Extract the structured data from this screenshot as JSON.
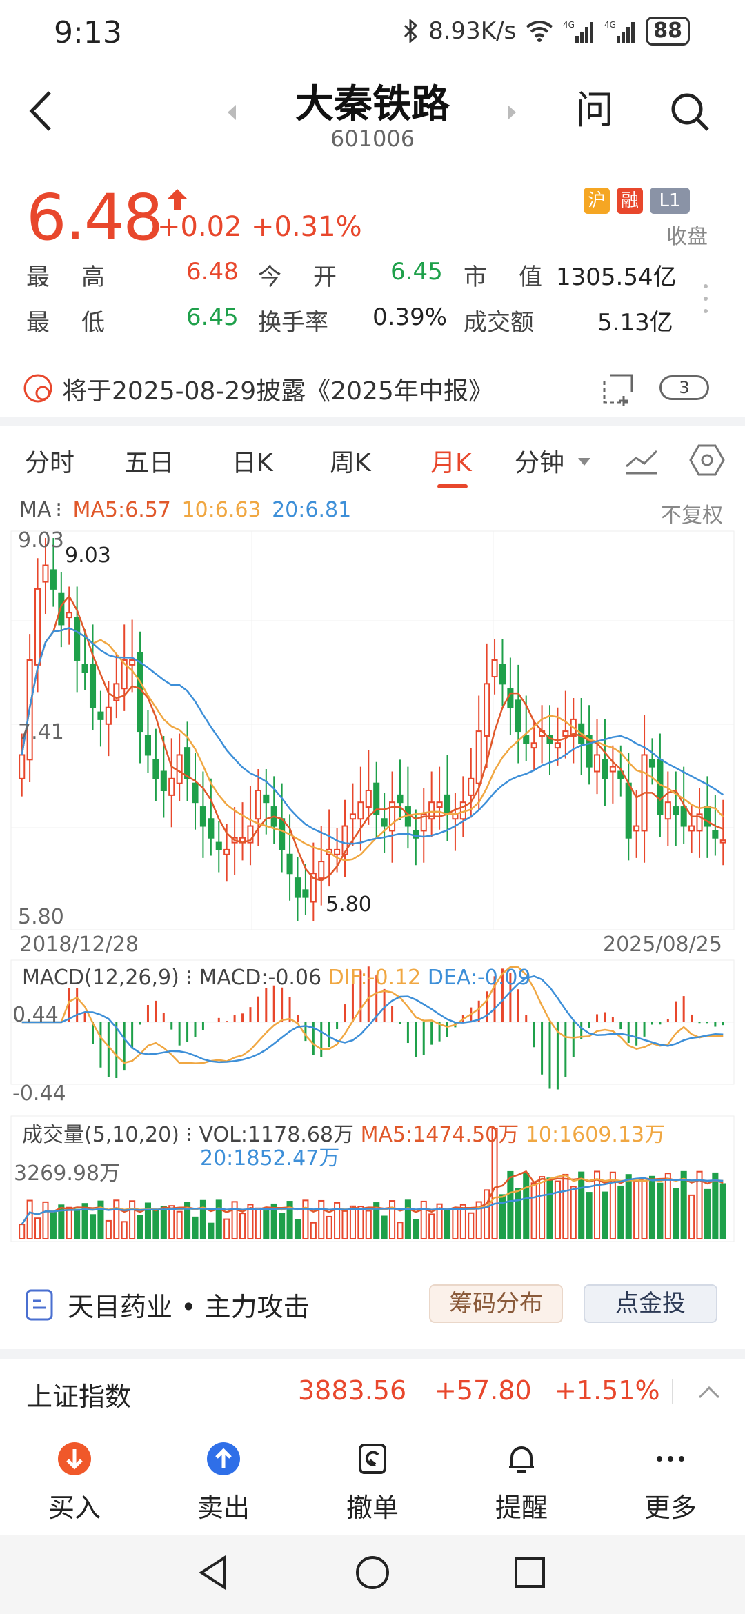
{
  "status_bar": {
    "time": "9:13",
    "net_speed": "8.93K/s",
    "battery": "88",
    "signal1": "4G",
    "signal2": "4G"
  },
  "nav": {
    "title": "大秦铁路",
    "code": "601006",
    "ask_label": "问"
  },
  "quote": {
    "price": "6.48",
    "change": "+0.02",
    "change_pct": "+0.31%",
    "badges": {
      "sh": "沪",
      "rong": "融",
      "level": "L1"
    },
    "status": "收盘",
    "high_label": "最　高",
    "high": "6.48",
    "open_label": "今　开",
    "open": "6.45",
    "mktcap_label": "市　值",
    "mktcap": "1305.54亿",
    "low_label": "最　低",
    "low": "6.45",
    "turnover_label": "换手率",
    "turnover": "0.39%",
    "amount_label": "成交额",
    "amount": "5.13亿"
  },
  "disclosure": {
    "text": "将于2025-08-29披露《2025年中报》",
    "count": "3"
  },
  "tabs": [
    {
      "label": "分时"
    },
    {
      "label": "五日"
    },
    {
      "label": "日K"
    },
    {
      "label": "周K"
    },
    {
      "label": "月K"
    },
    {
      "label": "分钟"
    }
  ],
  "chart": {
    "ma_prefix": "MA",
    "ma5": "MA5:6.57",
    "ma10": "10:6.63",
    "ma20": "20:6.81",
    "adjust": "不复权",
    "y_top": "9.03",
    "y_mid": "7.41",
    "y_bottom": "5.80",
    "max_marker": "9.03",
    "min_marker": "5.80",
    "date_start": "2018/12/28",
    "date_end": "2025/08/25",
    "macd_title": "MACD(12,26,9)",
    "macd_val": "MACD:-0.06",
    "dif": "DIF:-0.12",
    "dea": "DEA:-0.09",
    "macd_top": "0.44",
    "macd_bottom": "-0.44",
    "vol_title": "成交量(5,10,20)",
    "vol": "VOL:1178.68万",
    "vol_ma5": "MA5:1474.50万",
    "vol_ma10": "10:1609.13万",
    "vol_ma20": "20:1852.47万",
    "vol_max": "3269.98万",
    "colors": {
      "up": "#e8472c",
      "down": "#1ea04a",
      "ma5": "#e0582a",
      "ma10": "#f0a742",
      "ma20": "#3d8fd8"
    }
  },
  "chart_data": {
    "type": "candlestick",
    "title": "月K",
    "ylim": [
      5.8,
      9.03
    ],
    "closes": [
      7.2,
      8.0,
      8.6,
      8.8,
      8.6,
      8.3,
      8.4,
      8.0,
      7.9,
      7.6,
      7.5,
      7.6,
      7.8,
      8.0,
      8.0,
      7.4,
      7.2,
      7.0,
      6.9,
      7.0,
      7.2,
      7.0,
      6.8,
      6.6,
      6.5,
      6.4,
      6.4,
      6.5,
      6.5,
      6.6,
      6.9,
      6.8,
      6.6,
      6.4,
      6.2,
      6.0,
      6.0,
      6.2,
      6.3,
      6.4,
      6.4,
      6.6,
      6.7,
      6.8,
      6.9,
      6.7,
      6.6,
      6.8,
      6.8,
      6.6,
      6.5,
      6.7,
      6.8,
      6.8,
      6.7,
      6.7,
      6.8,
      7.0,
      7.4,
      7.8,
      8.0,
      7.8,
      7.6,
      7.4,
      7.3,
      7.3,
      7.4,
      7.3,
      7.3,
      7.4,
      7.5,
      7.3,
      7.1,
      7.2,
      7.0,
      7.1,
      7.0,
      6.5,
      6.6,
      7.2,
      7.1,
      6.7,
      6.8,
      6.7,
      6.6,
      6.6,
      6.7,
      6.6,
      6.5,
      6.48
    ],
    "ma5": 6.57,
    "ma10": 6.63,
    "ma20": 6.81,
    "macd": -0.06,
    "dif": -0.12,
    "dea": -0.09,
    "volume_latest": "1178.68万"
  },
  "info_strip": {
    "text": "天目药业 • 主力攻击",
    "btn1": "筹码分布",
    "btn2": "点金投"
  },
  "index": {
    "name": "上证指数",
    "value": "3883.56",
    "change": "+57.80",
    "pct": "+1.51%"
  },
  "actions": [
    {
      "label": "买入"
    },
    {
      "label": "卖出"
    },
    {
      "label": "撤单"
    },
    {
      "label": "提醒"
    },
    {
      "label": "更多"
    }
  ]
}
